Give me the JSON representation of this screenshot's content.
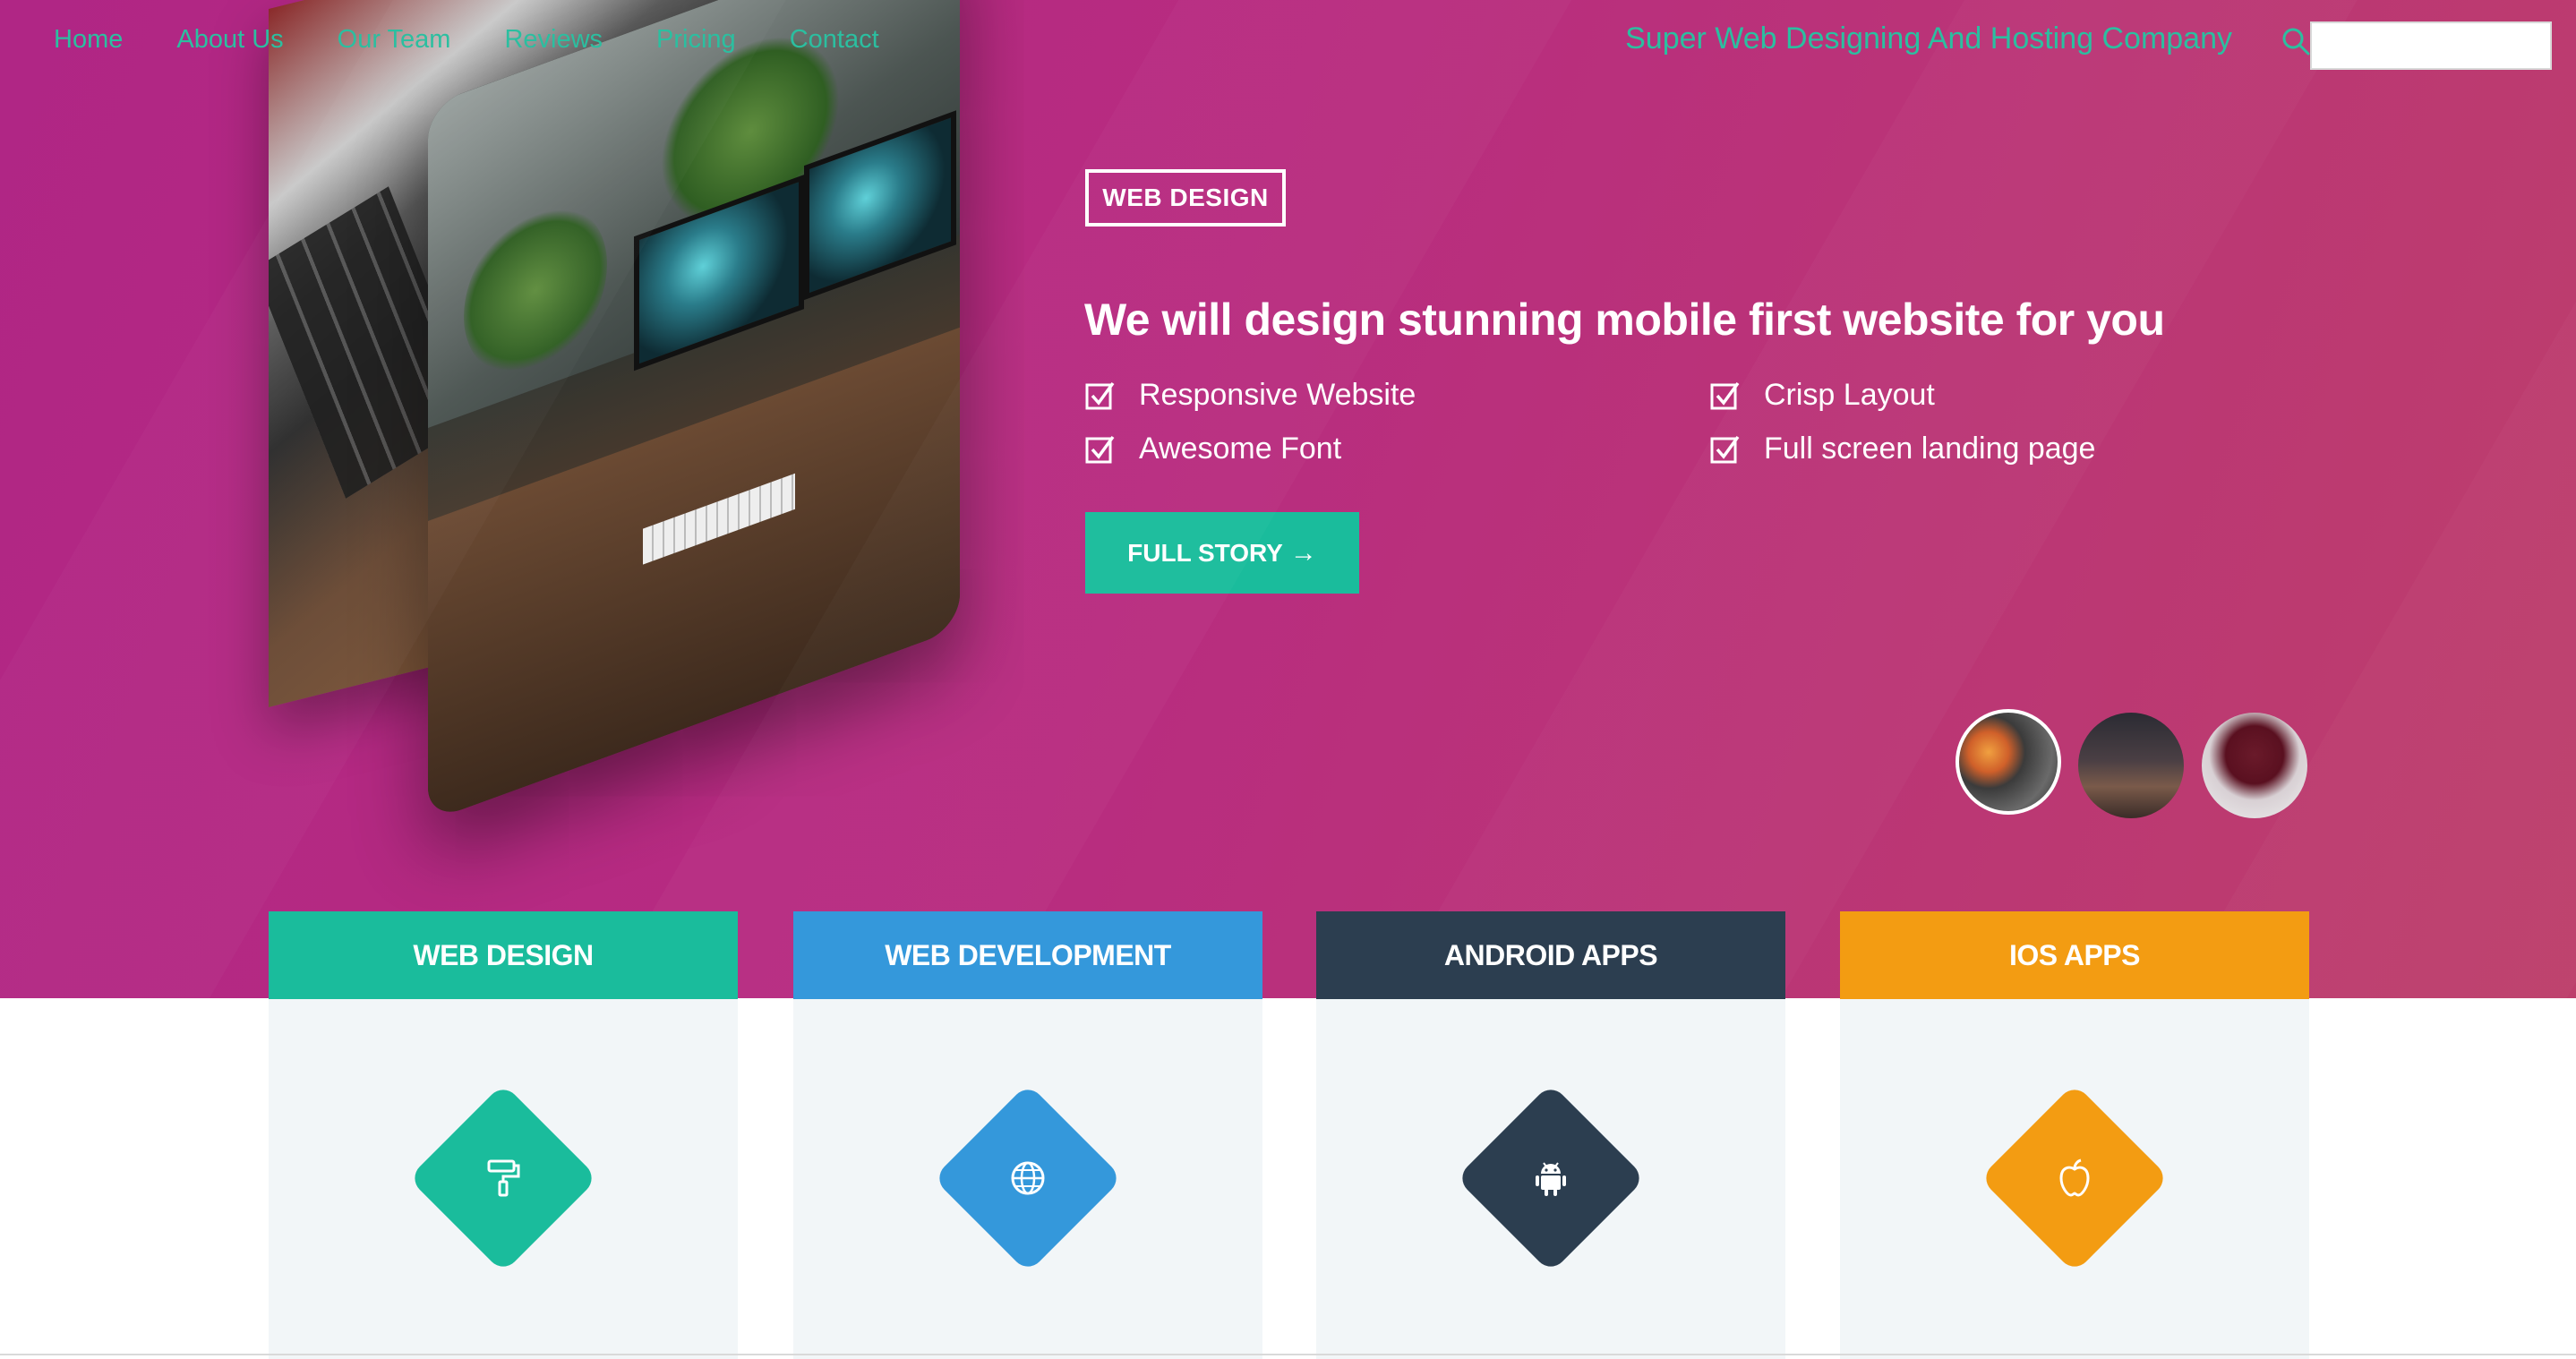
{
  "nav": {
    "links": [
      "Home",
      "About Us",
      "Our Team",
      "Reviews",
      "Pricing",
      "Contact"
    ],
    "brand": "Super Web Designing And Hosting Company",
    "search_placeholder": ""
  },
  "hero": {
    "tag": "WEB DESIGN",
    "headline": "We will design stunning mobile first website for you",
    "features": [
      "Responsive Website",
      "Crisp Layout",
      "Awesome Font",
      "Full screen landing page"
    ],
    "cta_label": "FULL STORY",
    "cta_icon": "arrow-right-icon",
    "thumbnails": [
      "headphones-phone-thumb",
      "desk-thumb",
      "wall-art-thumb"
    ],
    "active_thumbnail": 0
  },
  "services": [
    {
      "title": "WEB DESIGN",
      "icon": "paint-roller-icon",
      "color": "#1abc9c"
    },
    {
      "title": "WEB DEVELOPMENT",
      "icon": "globe-icon",
      "color": "#3498db"
    },
    {
      "title": "ANDROID APPS",
      "icon": "android-icon",
      "color": "#2c3e50"
    },
    {
      "title": "IOS APPS",
      "icon": "apple-icon",
      "color": "#f39c12"
    }
  ],
  "colors": {
    "accent": "#1abc9c",
    "nav_text": "#2bbfa0",
    "hero_bg_start": "#b02685",
    "hero_bg_end": "#bd3f6b"
  }
}
